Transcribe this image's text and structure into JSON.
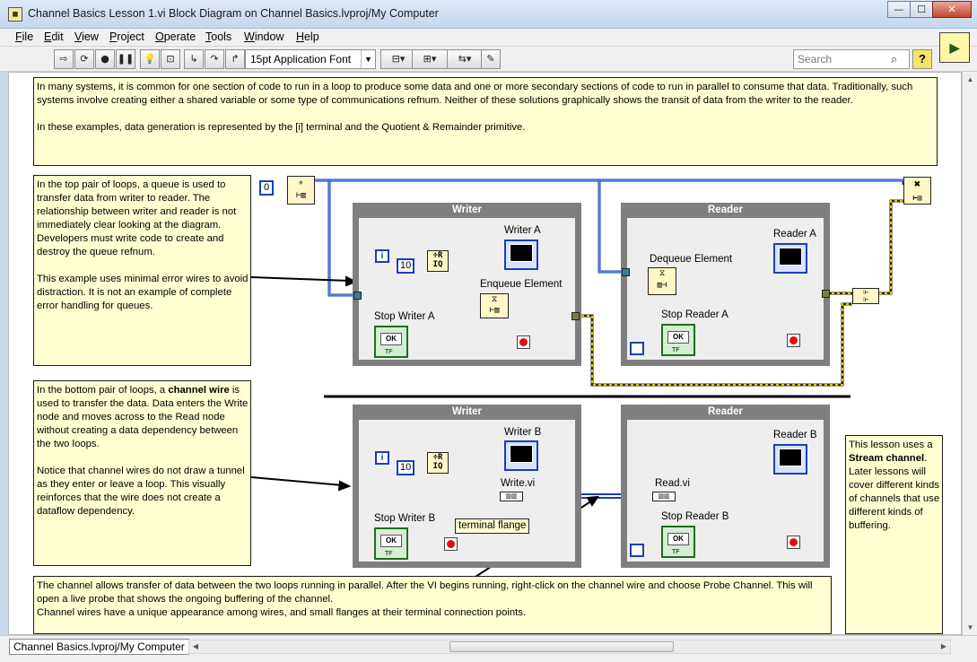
{
  "window": {
    "title": "Channel Basics Lesson 1.vi Block Diagram on Channel Basics.lvproj/My Computer",
    "icon": "labview-diagram-icon",
    "controls": {
      "minimize": "—",
      "maximize": "☐",
      "close": "✕"
    }
  },
  "menu": {
    "items": [
      {
        "label": "File",
        "u": "F",
        "rest": "ile"
      },
      {
        "label": "Edit",
        "u": "E",
        "rest": "dit"
      },
      {
        "label": "View",
        "u": "V",
        "rest": "iew"
      },
      {
        "label": "Project",
        "u": "P",
        "rest": "roject"
      },
      {
        "label": "Operate",
        "u": "O",
        "rest": "perate"
      },
      {
        "label": "Tools",
        "u": "T",
        "rest": "ools"
      },
      {
        "label": "Window",
        "u": "W",
        "rest": "indow"
      },
      {
        "label": "Help",
        "u": "H",
        "rest": "elp"
      }
    ]
  },
  "toolbar": {
    "font": "15pt Application Font",
    "search_placeholder": "Search",
    "help": "?",
    "icons": [
      "run-arrow-icon",
      "run-continuously-icon",
      "abort-icon",
      "pause-icon",
      "highlight-execution-icon",
      "retain-wire-values-icon",
      "step-into-icon",
      "step-over-icon",
      "step-out-icon",
      "align-objects-icon",
      "distribute-objects-icon",
      "reorder-icon",
      "cleanup-diagram-icon"
    ]
  },
  "notes": {
    "top": "In many systems, it is common for one section of code to run in a loop to produce some data and one or more secondary sections of code to run in parallel to consume that data. Traditionally, such systems involve creating either a shared variable or some type of communications refnum. Neither of these solutions graphically shows the transit of data from the writer to the reader.\n\nIn these examples, data generation is represented by the [i] terminal and the Quotient & Remainder primitive.",
    "queue": "In the top pair of loops, a queue is used to transfer data from writer to reader. The relationship between writer and reader is not immediately clear looking at the diagram. Developers must write code to create and destroy the queue refnum.\n\nThis example uses minimal error wires to avoid distraction. It is not an example of complete error handling for queues.",
    "channel_a": "In the bottom pair of loops, a ",
    "channel_bold": "channel wire",
    "channel_b": " is used to transfer the data. Data enters the Write node and moves across to the Read node without creating a data dependency between the two loops.\n\nNotice that channel wires do not draw a tunnel as they enter or leave a loop. This visually reinforces that the wire does not create a dataflow dependency.",
    "bottom": "The channel allows transfer of data between the two loops running in parallel. After the VI begins running, right-click on the channel wire and choose Probe Channel. This will open a live probe that shows the ongoing buffering of the channel.\nChannel wires have a unique appearance among wires, and small flanges at their terminal connection points.",
    "stream_a": "This lesson uses a ",
    "stream_bold": "Stream channel",
    "stream_b": ". Later lessons will cover different kinds of channels that use different kinds of buffering."
  },
  "diagram": {
    "const_zero": "0",
    "top": {
      "writer_title": "Writer",
      "reader_title": "Reader",
      "iter": "i",
      "const_ten": "10",
      "chart_w": "Writer A",
      "chart_r": "Reader A",
      "enqueue": "Enqueue Element",
      "dequeue": "Dequeue Element",
      "stop_w": "Stop Writer A",
      "stop_r": "Stop Reader A"
    },
    "bottom": {
      "writer_title": "Writer",
      "reader_title": "Reader",
      "iter": "i",
      "const_ten": "10",
      "chart_w": "Writer B",
      "chart_r": "Reader B",
      "write_vi": "Write.vi",
      "read_vi": "Read.vi",
      "flange": "terminal flange",
      "stop_w": "Stop Writer B",
      "stop_r": "Stop Reader B"
    },
    "ok": "OK",
    "tf": "TF",
    "qr": "÷R IQ"
  },
  "status": {
    "context": "Channel Basics.lvproj/My Computer"
  }
}
